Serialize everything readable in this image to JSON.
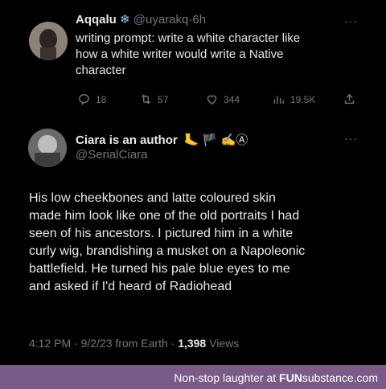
{
  "tweet1": {
    "name": "Aqqalu",
    "badge": "❄",
    "handle": "@uyarakq",
    "sep": "·",
    "time": "6h",
    "text_lines": [
      "writing prompt: write a white character like",
      "how a white writer would write a Native",
      "character"
    ],
    "replies": "18",
    "retweets": "57",
    "likes": "344",
    "views": "19.5K",
    "more": "···"
  },
  "tweet2": {
    "name": "Ciara is an author",
    "name_emoji": "🦶 🏴 ✍Ⓐ",
    "handle": "@SerialCiara",
    "more": "···",
    "body_lines": [
      "His low cheekbones and latte coloured skin",
      "made him look like one of the old portraits I had",
      "seen of his ancestors. I pictured him in a white",
      "curly wig, brandishing a musket on a Napoleonic",
      "battlefield. He turned his pale blue eyes to me",
      "and asked if I'd heard of Radiohead"
    ],
    "meta_time": "4:12 PM · 9/2/23 from Earth · ",
    "meta_views_count": "1,398",
    "meta_views_label": " Views"
  },
  "footer": {
    "text_prefix": "Non-stop laughter at ",
    "brand_bold": "FUN",
    "brand_rest": "substance.com"
  },
  "colors": {
    "background": "#000000",
    "text": "#e7e9ea",
    "dim": "#71767b",
    "footer": "#7a5a86"
  }
}
